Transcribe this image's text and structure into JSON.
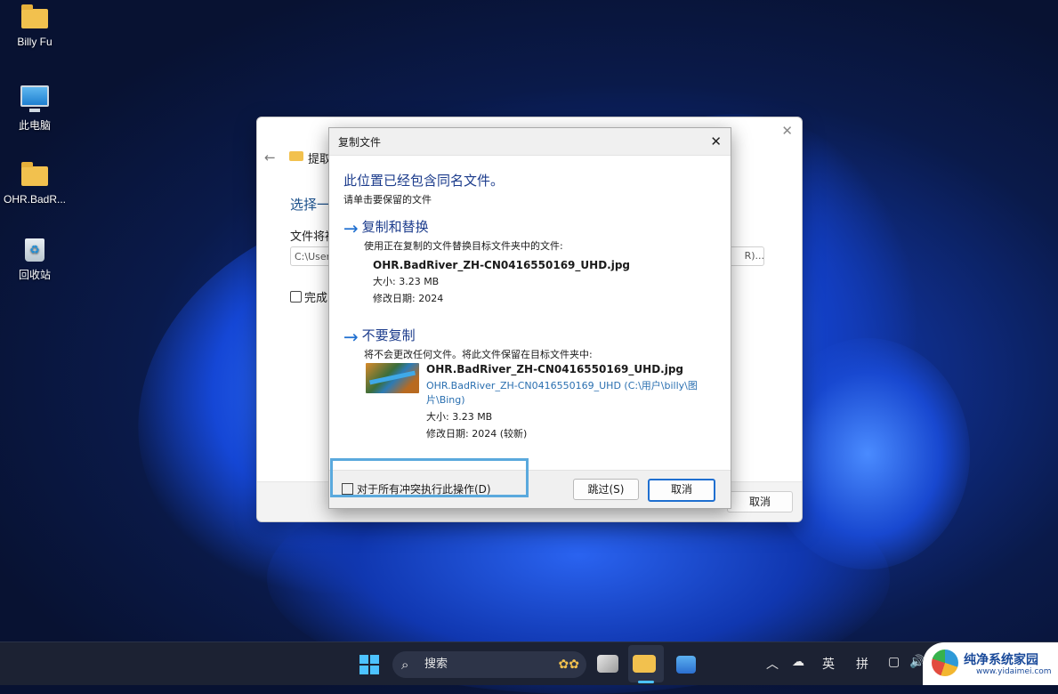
{
  "desktop": {
    "icons": [
      {
        "label": "Billy Fu",
        "icon": "folder-icon"
      },
      {
        "label": "此电脑",
        "icon": "computer-icon"
      },
      {
        "label": "OHR.BadR...",
        "icon": "zip-folder-icon"
      },
      {
        "label": "回收站",
        "icon": "recycle-bin-icon"
      }
    ]
  },
  "extract_window": {
    "breadcrumb": "提取",
    "heading": "选择一",
    "path_label": "文件将被",
    "path_value": "C:\\User",
    "browse_label": "R)...",
    "checkbox_label": "完成",
    "cancel_label": "取消"
  },
  "copy_dialog": {
    "title": "复制文件",
    "heading": "此位置已经包含同名文件。",
    "subheading": "请单击要保留的文件",
    "replace": {
      "title": "复制和替换",
      "desc": "使用正在复制的文件替换目标文件夹中的文件:",
      "filename": "OHR.BadRiver_ZH-CN0416550169_UHD.jpg",
      "size": "大小: 3.23 MB",
      "date": "修改日期: 2024"
    },
    "skip": {
      "title": "不要复制",
      "desc": "将不会更改任何文件。将此文件保留在目标文件夹中:",
      "filename": "OHR.BadRiver_ZH-CN0416550169_UHD.jpg",
      "location": "OHR.BadRiver_ZH-CN0416550169_UHD (C:\\用户\\billy\\图片\\Bing)",
      "size": "大小: 3.23 MB",
      "date": "修改日期: 2024 (较新)"
    },
    "apply_all_label": "对于所有冲突执行此操作(D)",
    "skip_button": "跳过(S)",
    "cancel_button": "取消"
  },
  "taskbar": {
    "search_placeholder": "搜索",
    "ime_lang": "英",
    "ime_mode": "拼"
  },
  "watermark": {
    "name": "纯净系统家园",
    "url": "www.yidaimei.com"
  }
}
